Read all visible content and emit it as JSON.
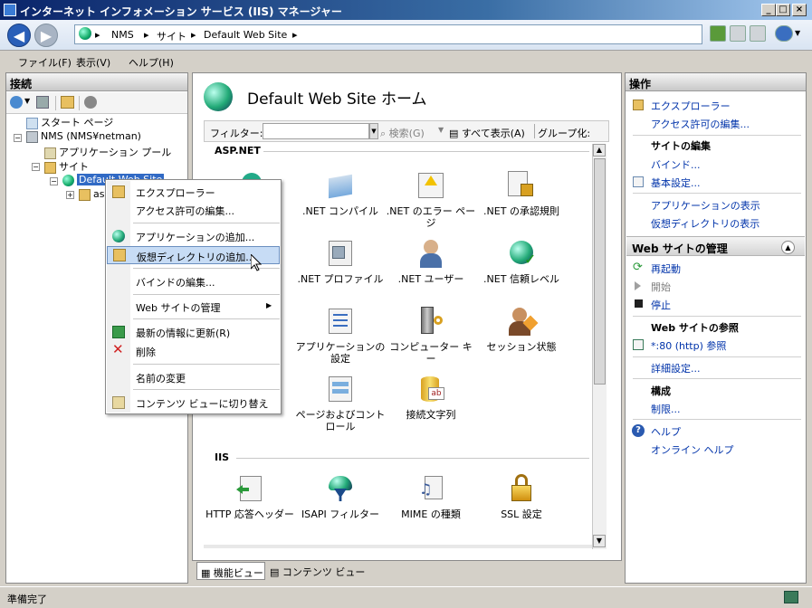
{
  "window": {
    "title": "インターネット インフォメーション サービス (IIS) マネージャー"
  },
  "address": {
    "crumbs": [
      "NMS",
      "サイト",
      "Default Web Site"
    ]
  },
  "menu": {
    "items": [
      "ファイル(F)",
      "表示(V)",
      "ヘルプ(H)"
    ]
  },
  "connections": {
    "title": "接続",
    "tree": {
      "start_page": "スタート ページ",
      "server": "NMS (NMS¥netman)",
      "app_pools": "アプリケーション プール",
      "sites": "サイト",
      "default_site": "Default Web Site",
      "child": "as"
    }
  },
  "context_menu": {
    "items": [
      "エクスプローラー",
      "アクセス許可の編集...",
      "アプリケーションの追加...",
      "仮想ディレクトリの追加...",
      "バインドの編集...",
      "Web サイトの管理",
      "最新の情報に更新(R)",
      "削除",
      "名前の変更",
      "コンテンツ ビューに切り替え"
    ],
    "highlighted_index": 3
  },
  "center": {
    "title": "Default Web Site ホーム",
    "filter_label": "フィルター:",
    "search_label": "検索(G)",
    "show_all_label": "すべて表示(A)",
    "group_label": "グループ化:",
    "section_aspnet": "ASP.NET",
    "section_iis": "IIS",
    "aspnet_items": [
      "",
      ".NET コンパイル",
      ".NET のエラー ページ",
      ".NET の承認規則",
      "",
      ".NET プロファイル",
      ".NET ユーザー",
      ".NET 信頼レベル",
      "ル",
      "アプリケーションの設定",
      "コンピューター キー",
      "セッション状態",
      "",
      "ページおよびコントロール",
      "接続文字列"
    ],
    "iis_items": [
      "HTTP 応答ヘッダー",
      "ISAPI フィルター",
      "MIME の種類",
      "SSL 設定"
    ],
    "bottom_tabs": [
      "機能ビュー",
      "コンテンツ ビュー"
    ]
  },
  "actions": {
    "title": "操作",
    "explorer": "エクスプローラー",
    "edit_permissions": "アクセス許可の編集...",
    "site_edit_head": "サイトの編集",
    "bindings": "バインド...",
    "basic_settings": "基本設定...",
    "view_apps": "アプリケーションの表示",
    "view_vdirs": "仮想ディレクトリの表示",
    "manage_head": "Web サイトの管理",
    "restart": "再起動",
    "start": "開始",
    "stop": "停止",
    "browse_head": "Web サイトの参照",
    "browse_80": "*:80 (http) 参照",
    "advanced": "詳細設定...",
    "config_head": "構成",
    "limits": "制限...",
    "help": "ヘルプ",
    "online_help": "オンライン ヘルプ"
  },
  "status": {
    "text": "準備完了"
  }
}
